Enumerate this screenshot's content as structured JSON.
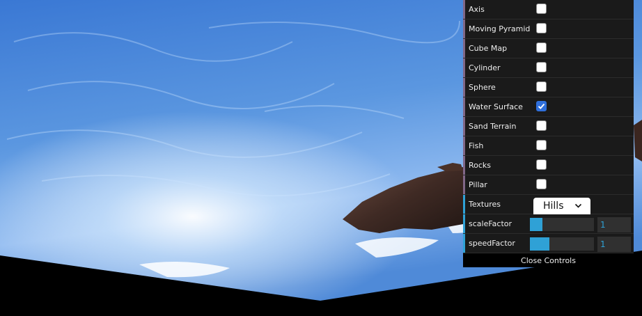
{
  "controls": {
    "toggles": [
      {
        "label": "Axis",
        "checked": false
      },
      {
        "label": "Moving Pyramid",
        "checked": false
      },
      {
        "label": "Cube Map",
        "checked": false
      },
      {
        "label": "Cylinder",
        "checked": false
      },
      {
        "label": "Sphere",
        "checked": false
      },
      {
        "label": "Water Surface",
        "checked": true
      },
      {
        "label": "Sand Terrain",
        "checked": false
      },
      {
        "label": "Fish",
        "checked": false
      },
      {
        "label": "Rocks",
        "checked": false
      },
      {
        "label": "Pillar",
        "checked": false
      }
    ],
    "textures": {
      "label": "Textures",
      "value": "Hills"
    },
    "scale_factor": {
      "label": "scaleFactor",
      "value": "1",
      "fill": 0.2
    },
    "speed_factor": {
      "label": "speedFactor",
      "value": "1",
      "fill": 0.3
    },
    "close_label": "Close Controls"
  },
  "colors": {
    "folder_accent": "#806787",
    "number_accent": "#2fa1d6",
    "checkbox_on": "#2f6fdb",
    "panel_bg": "#1a1a1a"
  }
}
